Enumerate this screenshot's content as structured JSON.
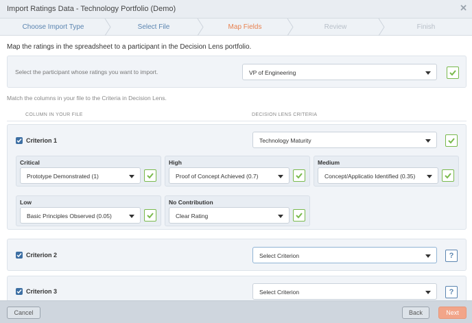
{
  "window": {
    "title": "Import Ratings Data - Technology Portfolio (Demo)"
  },
  "wizard": {
    "steps": [
      {
        "label": "Choose Import Type",
        "state": "done"
      },
      {
        "label": "Select File",
        "state": "done"
      },
      {
        "label": "Map Fields",
        "state": "active"
      },
      {
        "label": "Review",
        "state": "pending"
      },
      {
        "label": "Finish",
        "state": "pending"
      }
    ]
  },
  "intro": "Map the ratings in the spreadsheet to a participant in the Decision Lens portfolio.",
  "participant": {
    "prompt": "Select the participant whose ratings you want to import.",
    "selected": "VP of Engineering"
  },
  "match_text": "Match the columns in your file to the Criteria in Decision Lens.",
  "headers": {
    "column": "COLUMN IN YOUR FILE",
    "criteria": "DECISION LENS CRITERIA"
  },
  "criteria": [
    {
      "name": "Criterion 1",
      "selected": "Technology Maturity",
      "levels": [
        {
          "name": "Critical",
          "value": "Prototype Demonstrated (1)"
        },
        {
          "name": "High",
          "value": "Proof of Concept Achieved (0.7)"
        },
        {
          "name": "Medium",
          "value": "Concept/Applicatio Identified (0.35)"
        },
        {
          "name": "Low",
          "value": "Basic Principles Observed (0.05)"
        },
        {
          "name": "No Contribution",
          "value": "Clear Rating"
        }
      ]
    },
    {
      "name": "Criterion 2",
      "selected": "Select Criterion"
    },
    {
      "name": "Criterion 3",
      "selected": "Select Criterion"
    }
  ],
  "footer": {
    "cancel": "Cancel",
    "back": "Back",
    "next": "Next"
  },
  "colors": {
    "accent": "#e8814f",
    "link": "#5a84b0",
    "ok": "#78b94b",
    "checkbox": "#3d6fa3"
  },
  "icons": {
    "close": "close-icon",
    "check": "check-icon",
    "help": "help-icon",
    "caret": "caret-down-icon"
  }
}
